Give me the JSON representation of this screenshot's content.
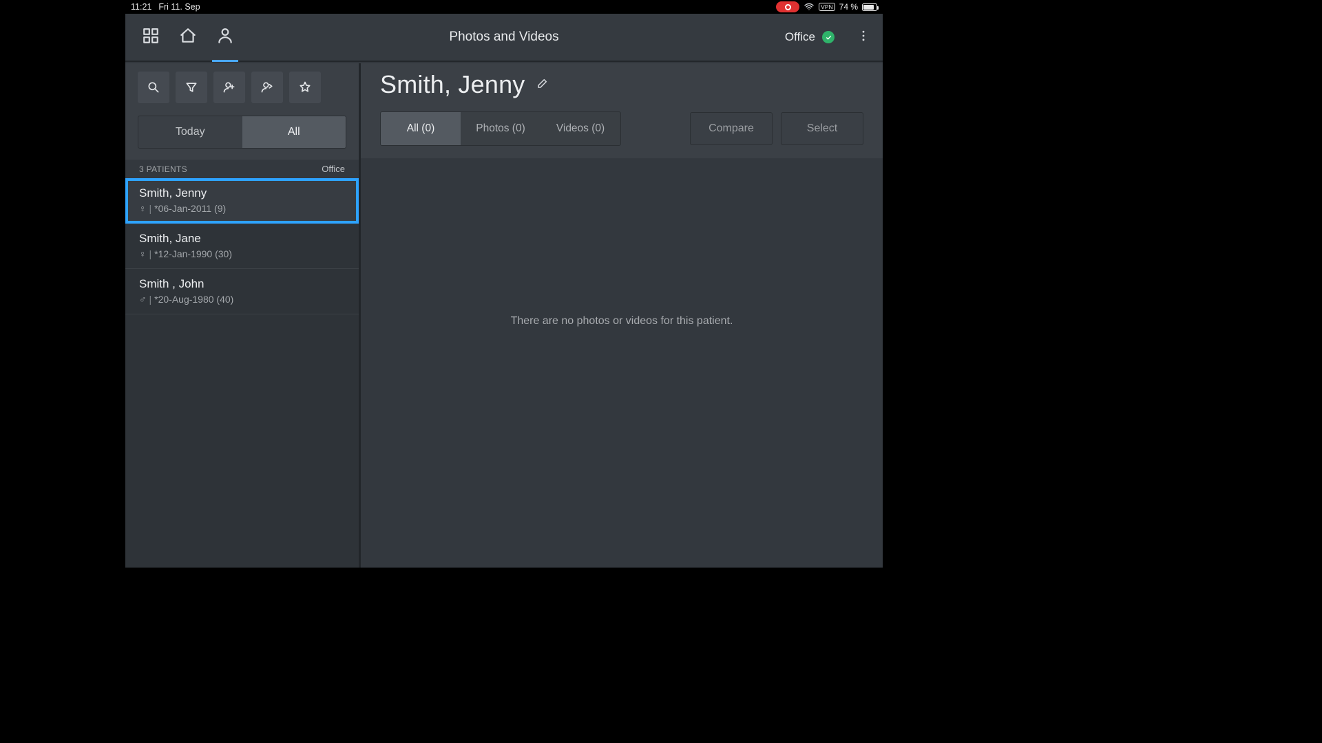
{
  "statusbar": {
    "time": "11:21",
    "date": "Fri 11. Sep",
    "battery": "74 %",
    "vpn": "VPN"
  },
  "appbar": {
    "title": "Photos and Videos",
    "location": "Office"
  },
  "sidebar": {
    "segment": {
      "today": "Today",
      "all": "All"
    },
    "count_label": "3 PATIENTS",
    "location": "Office",
    "patients": [
      {
        "name": "Smith, Jenny",
        "gender": "♀",
        "dob": "*06-Jan-2011 (9)",
        "selected": true
      },
      {
        "name": "Smith, Jane",
        "gender": "♀",
        "dob": "*12-Jan-1990 (30)",
        "selected": false
      },
      {
        "name": "Smith , John",
        "gender": "♂",
        "dob": "*20-Aug-1980 (40)",
        "selected": false
      }
    ]
  },
  "main": {
    "patient_name": "Smith, Jenny",
    "tabs": {
      "all": "All (0)",
      "photos": "Photos (0)",
      "videos": "Videos (0)"
    },
    "actions": {
      "compare": "Compare",
      "select": "Select"
    },
    "empty": "There are no photos or videos for this patient."
  }
}
